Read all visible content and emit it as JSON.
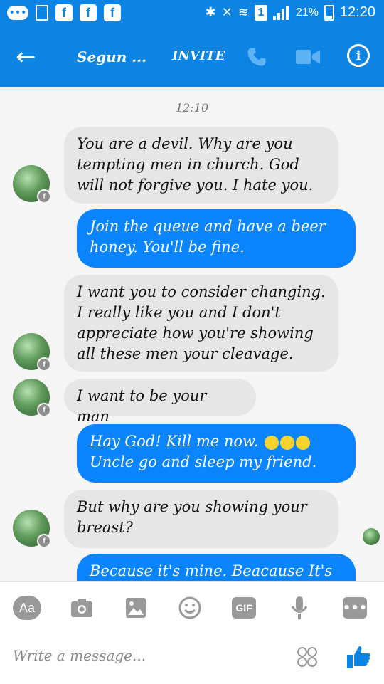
{
  "status_bar": {
    "battery_text": "21%",
    "time": "12:20",
    "sim_label": "1"
  },
  "header": {
    "contact_name": "Segun ...",
    "invite_label": "INVITE"
  },
  "chat": {
    "timestamp": "12:10",
    "messages": [
      {
        "dir": "in",
        "text": "You are a devil. Why are you tempting men in church. God will not forgive you. I hate you."
      },
      {
        "dir": "out",
        "text": "Join the queue and have a beer honey. You'll be fine."
      },
      {
        "dir": "in",
        "text": "I want you to consider changing. I really like you and I don't appreciate how you're showing all these men your cleavage."
      },
      {
        "dir": "in",
        "text": "I want to be your man"
      },
      {
        "dir": "out",
        "text": "Hay God! Kill me now.",
        "text2": "Uncle go and sleep my friend."
      },
      {
        "dir": "in",
        "text": "But why are you showing your breast?"
      },
      {
        "dir": "out",
        "text": "Because it's mine. Beacause It's"
      }
    ]
  },
  "composer": {
    "aa_label": "Aa",
    "gif_label": "GIF",
    "more_label": "•••",
    "placeholder": "Write a message..."
  },
  "icons": {
    "back": "arrow-left-icon",
    "phone": "phone-icon",
    "video": "video-camera-icon",
    "info": "info-icon",
    "camera": "camera-icon",
    "gallery": "image-icon",
    "emoji": "smiley-icon",
    "mic": "microphone-icon",
    "stickers": "stickers-icon",
    "like": "thumbs-up-icon"
  },
  "colors": {
    "brand_blue": "#0c84e4",
    "outgoing_bubble": "#0a84ff",
    "incoming_bubble": "#e6e6e6"
  }
}
